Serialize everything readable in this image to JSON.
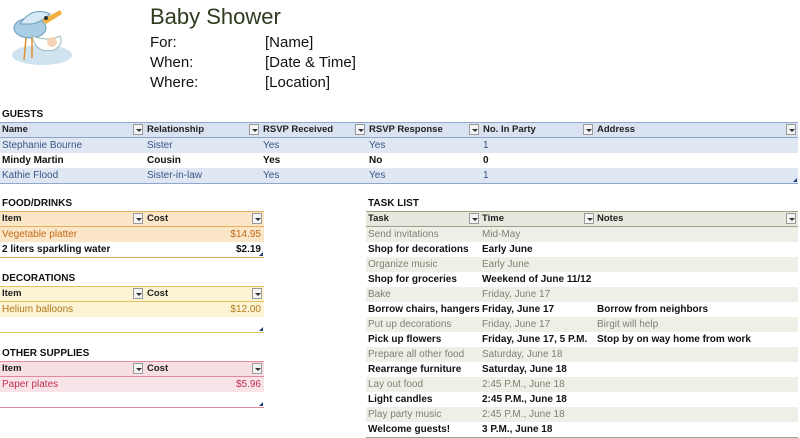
{
  "header": {
    "title": "Baby Shower",
    "rows": [
      {
        "label": "For:",
        "value": "[Name]"
      },
      {
        "label": "When:",
        "value": "[Date & Time]"
      },
      {
        "label": "Where:",
        "value": "[Location]"
      }
    ],
    "logo_icon": "stork-carrying-baby-icon"
  },
  "guests": {
    "title": "GUESTS",
    "columns": [
      "Name",
      "Relationship",
      "RSVP Received",
      "RSVP Response",
      "No. In Party",
      "Address"
    ],
    "rows": [
      [
        "Stephanie Bourne",
        "Sister",
        "Yes",
        "Yes",
        "1",
        ""
      ],
      [
        "Mindy Martin",
        "Cousin",
        "Yes",
        "No",
        "0",
        ""
      ],
      [
        "Kathie Flood",
        "Sister-in-law",
        "Yes",
        "Yes",
        "1",
        ""
      ]
    ]
  },
  "food": {
    "title": "FOOD/DRINKS",
    "columns": [
      "Item",
      "Cost"
    ],
    "rows": [
      [
        "Vegetable platter",
        "$14.95"
      ],
      [
        "2 liters sparkling water",
        "$2.19"
      ]
    ]
  },
  "decorations": {
    "title": "DECORATIONS",
    "columns": [
      "Item",
      "Cost"
    ],
    "rows": [
      [
        "Helium balloons",
        "$12.00"
      ]
    ]
  },
  "supplies": {
    "title": "OTHER SUPPLIES",
    "columns": [
      "Item",
      "Cost"
    ],
    "rows": [
      [
        "Paper plates",
        "$5.96"
      ]
    ]
  },
  "tasks": {
    "title": "TASK LIST",
    "columns": [
      "Task",
      "Time",
      "Notes"
    ],
    "rows": [
      [
        "Send invitations",
        "Mid-May",
        ""
      ],
      [
        "Shop for decorations",
        "Early June",
        ""
      ],
      [
        "Organize music",
        "Early June",
        ""
      ],
      [
        "Shop for groceries",
        "Weekend of June 11/12",
        ""
      ],
      [
        "Bake",
        "Friday, June 17",
        ""
      ],
      [
        "Borrow chairs, hangers",
        "Friday, June 17",
        "Borrow from neighbors"
      ],
      [
        "Put up decorations",
        "Friday, June 17",
        "Birgit will help"
      ],
      [
        "Pick up flowers",
        "Friday, June 17, 5 P.M.",
        "Stop by on way home from work"
      ],
      [
        "Prepare all other food",
        "Saturday, June 18",
        ""
      ],
      [
        "Rearrange furniture",
        "Saturday, June 18",
        ""
      ],
      [
        "Lay out food",
        "2:45 P.M., June 18",
        ""
      ],
      [
        "Light candles",
        "2:45 P.M., June 18",
        ""
      ],
      [
        "Play party music",
        "2:45 P.M., June 18",
        ""
      ],
      [
        "Welcome guests!",
        "3 P.M., June 18",
        ""
      ]
    ]
  },
  "colors": {
    "guests_accent": "#8fa7cf",
    "food_accent": "#e3b15c",
    "decorations_accent": "#e3c35c",
    "supplies_accent": "#e08a9c",
    "tasks_accent": "#9aa385"
  }
}
